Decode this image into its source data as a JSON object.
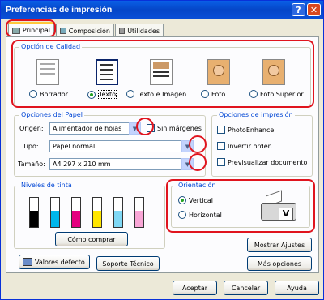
{
  "window": {
    "title": "Preferencias de impresión",
    "help_glyph": "?",
    "close_glyph": "✕"
  },
  "tabs": [
    {
      "label": "Principal"
    },
    {
      "label": "Composición"
    },
    {
      "label": "Utilidades"
    }
  ],
  "quality": {
    "title": "Opción de Calidad",
    "options": [
      "Borrador",
      "Texto",
      "Texto e Imagen",
      "Foto",
      "Foto Superior"
    ],
    "selected": "Texto"
  },
  "paper": {
    "title": "Opciones del Papel",
    "origen_label": "Origen:",
    "origen_value": "Alimentador de hojas",
    "sin_margenes": "Sin márgenes",
    "tipo_label": "Tipo:",
    "tipo_value": "Papel normal",
    "tamano_label": "Tamaño:",
    "tamano_value": "A4 297 x 210 mm"
  },
  "print_options": {
    "title": "Opciones de impresión",
    "items": [
      "PhotoEnhance",
      "Invertir orden",
      "Previsualizar documento"
    ]
  },
  "ink": {
    "title": "Niveles de tinta",
    "buy_button": "Cómo comprar",
    "levels": [
      {
        "color": "#000000",
        "level": 0.55
      },
      {
        "color": "#00b7eb",
        "level": 0.55
      },
      {
        "color": "#e4007f",
        "level": 0.55
      },
      {
        "color": "#ffe600",
        "level": 0.55
      },
      {
        "color": "#7fd8f5",
        "level": 0.55
      },
      {
        "color": "#f9a6d6",
        "level": 0.55
      }
    ]
  },
  "orientation": {
    "title": "Orientación",
    "options": [
      "Vertical",
      "Horizontal"
    ],
    "selected": "Vertical"
  },
  "buttons": {
    "valores_defecto": "Valores defecto",
    "soporte": "Soporte Técnico",
    "mostrar_ajustes": "Mostrar Ajustes",
    "mas_opciones": "Más opciones",
    "aceptar": "Aceptar",
    "cancelar": "Cancelar",
    "ayuda": "Ayuda"
  }
}
